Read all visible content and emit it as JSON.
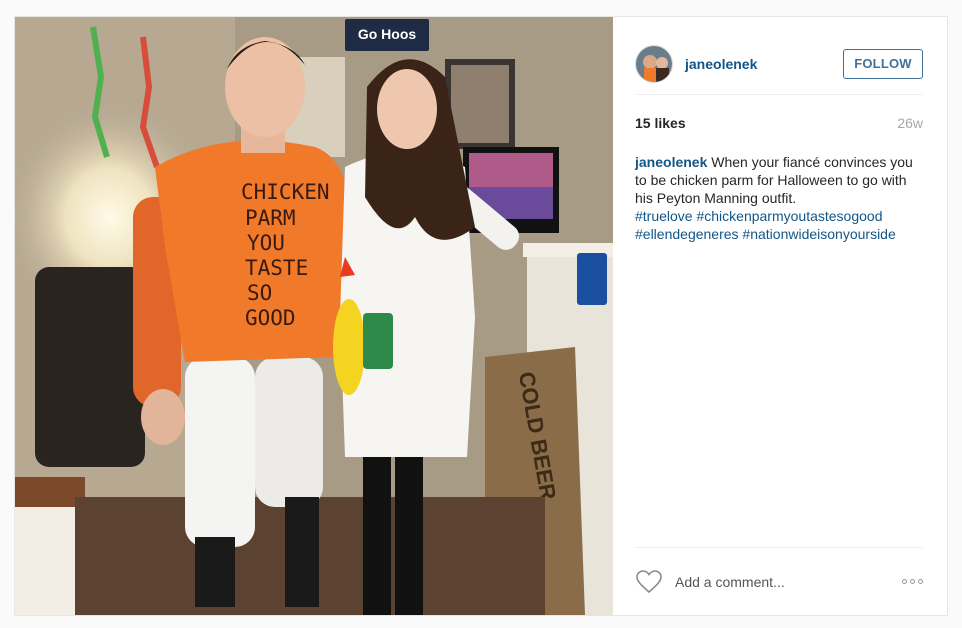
{
  "photo": {
    "alt_description": "",
    "sign_text": "Go Hoos",
    "shirt_lines": [
      "CHICKEN",
      "PARM",
      "YOU",
      "TASTE",
      "SO",
      "GOOD"
    ],
    "cardboard_text": "COLD BEER"
  },
  "header": {
    "username": "janeolenek",
    "follow_label": "FOLLOW"
  },
  "stats": {
    "likes": "15 likes",
    "age": "26w"
  },
  "caption": {
    "username": "janeolenek",
    "text": "When your fiancé convinces you to be chicken parm for Halloween to go with his Peyton Manning outfit.",
    "hashtags": [
      "#truelove",
      "#chickenparmyoutastesogood",
      "#ellendegeneres",
      "#nationwideisonyourside"
    ]
  },
  "footer": {
    "comment_placeholder": "Add a comment..."
  },
  "colors": {
    "link_blue": "#125688",
    "follow_blue": "#3f729b",
    "shirt_orange": "#f07a2a"
  }
}
